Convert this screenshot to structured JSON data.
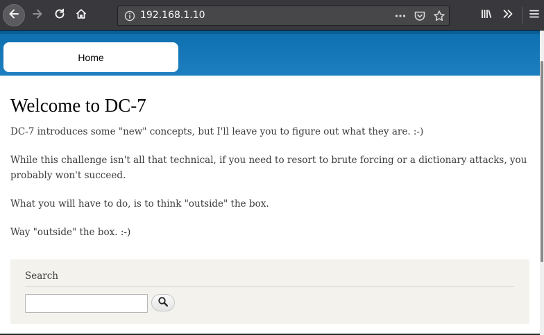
{
  "browser": {
    "url": "192.168.1.10"
  },
  "site": {
    "nav": {
      "home_label": "Home"
    }
  },
  "main": {
    "title": "Welcome to DC-7",
    "paragraphs": [
      "DC-7 introduces some \"new\" concepts, but I'll leave you to figure out what they are.  :-)",
      "While this challenge isn't all that technical, if you need to resort to brute forcing or a dictionary attacks, you probably won't succeed.",
      "What you will have to do, is to think \"outside\" the box.",
      "Way \"outside\" the box.  :-)"
    ]
  },
  "search": {
    "heading": "Search",
    "value": ""
  },
  "icons": {
    "back": "arrow-left-icon",
    "forward": "arrow-right-icon",
    "reload": "reload-icon",
    "home": "home-icon",
    "info": "info-icon",
    "page_actions": "more-dots-icon",
    "pocket": "pocket-icon",
    "bookmark": "star-icon",
    "library": "library-icon",
    "overflow": "double-chevron-icon",
    "menu": "hamburger-icon",
    "search": "magnifier-icon"
  },
  "colors": {
    "chrome_bg": "#38383d",
    "header_blue": "#1577b8",
    "search_block_bg": "#f3f2ed"
  }
}
